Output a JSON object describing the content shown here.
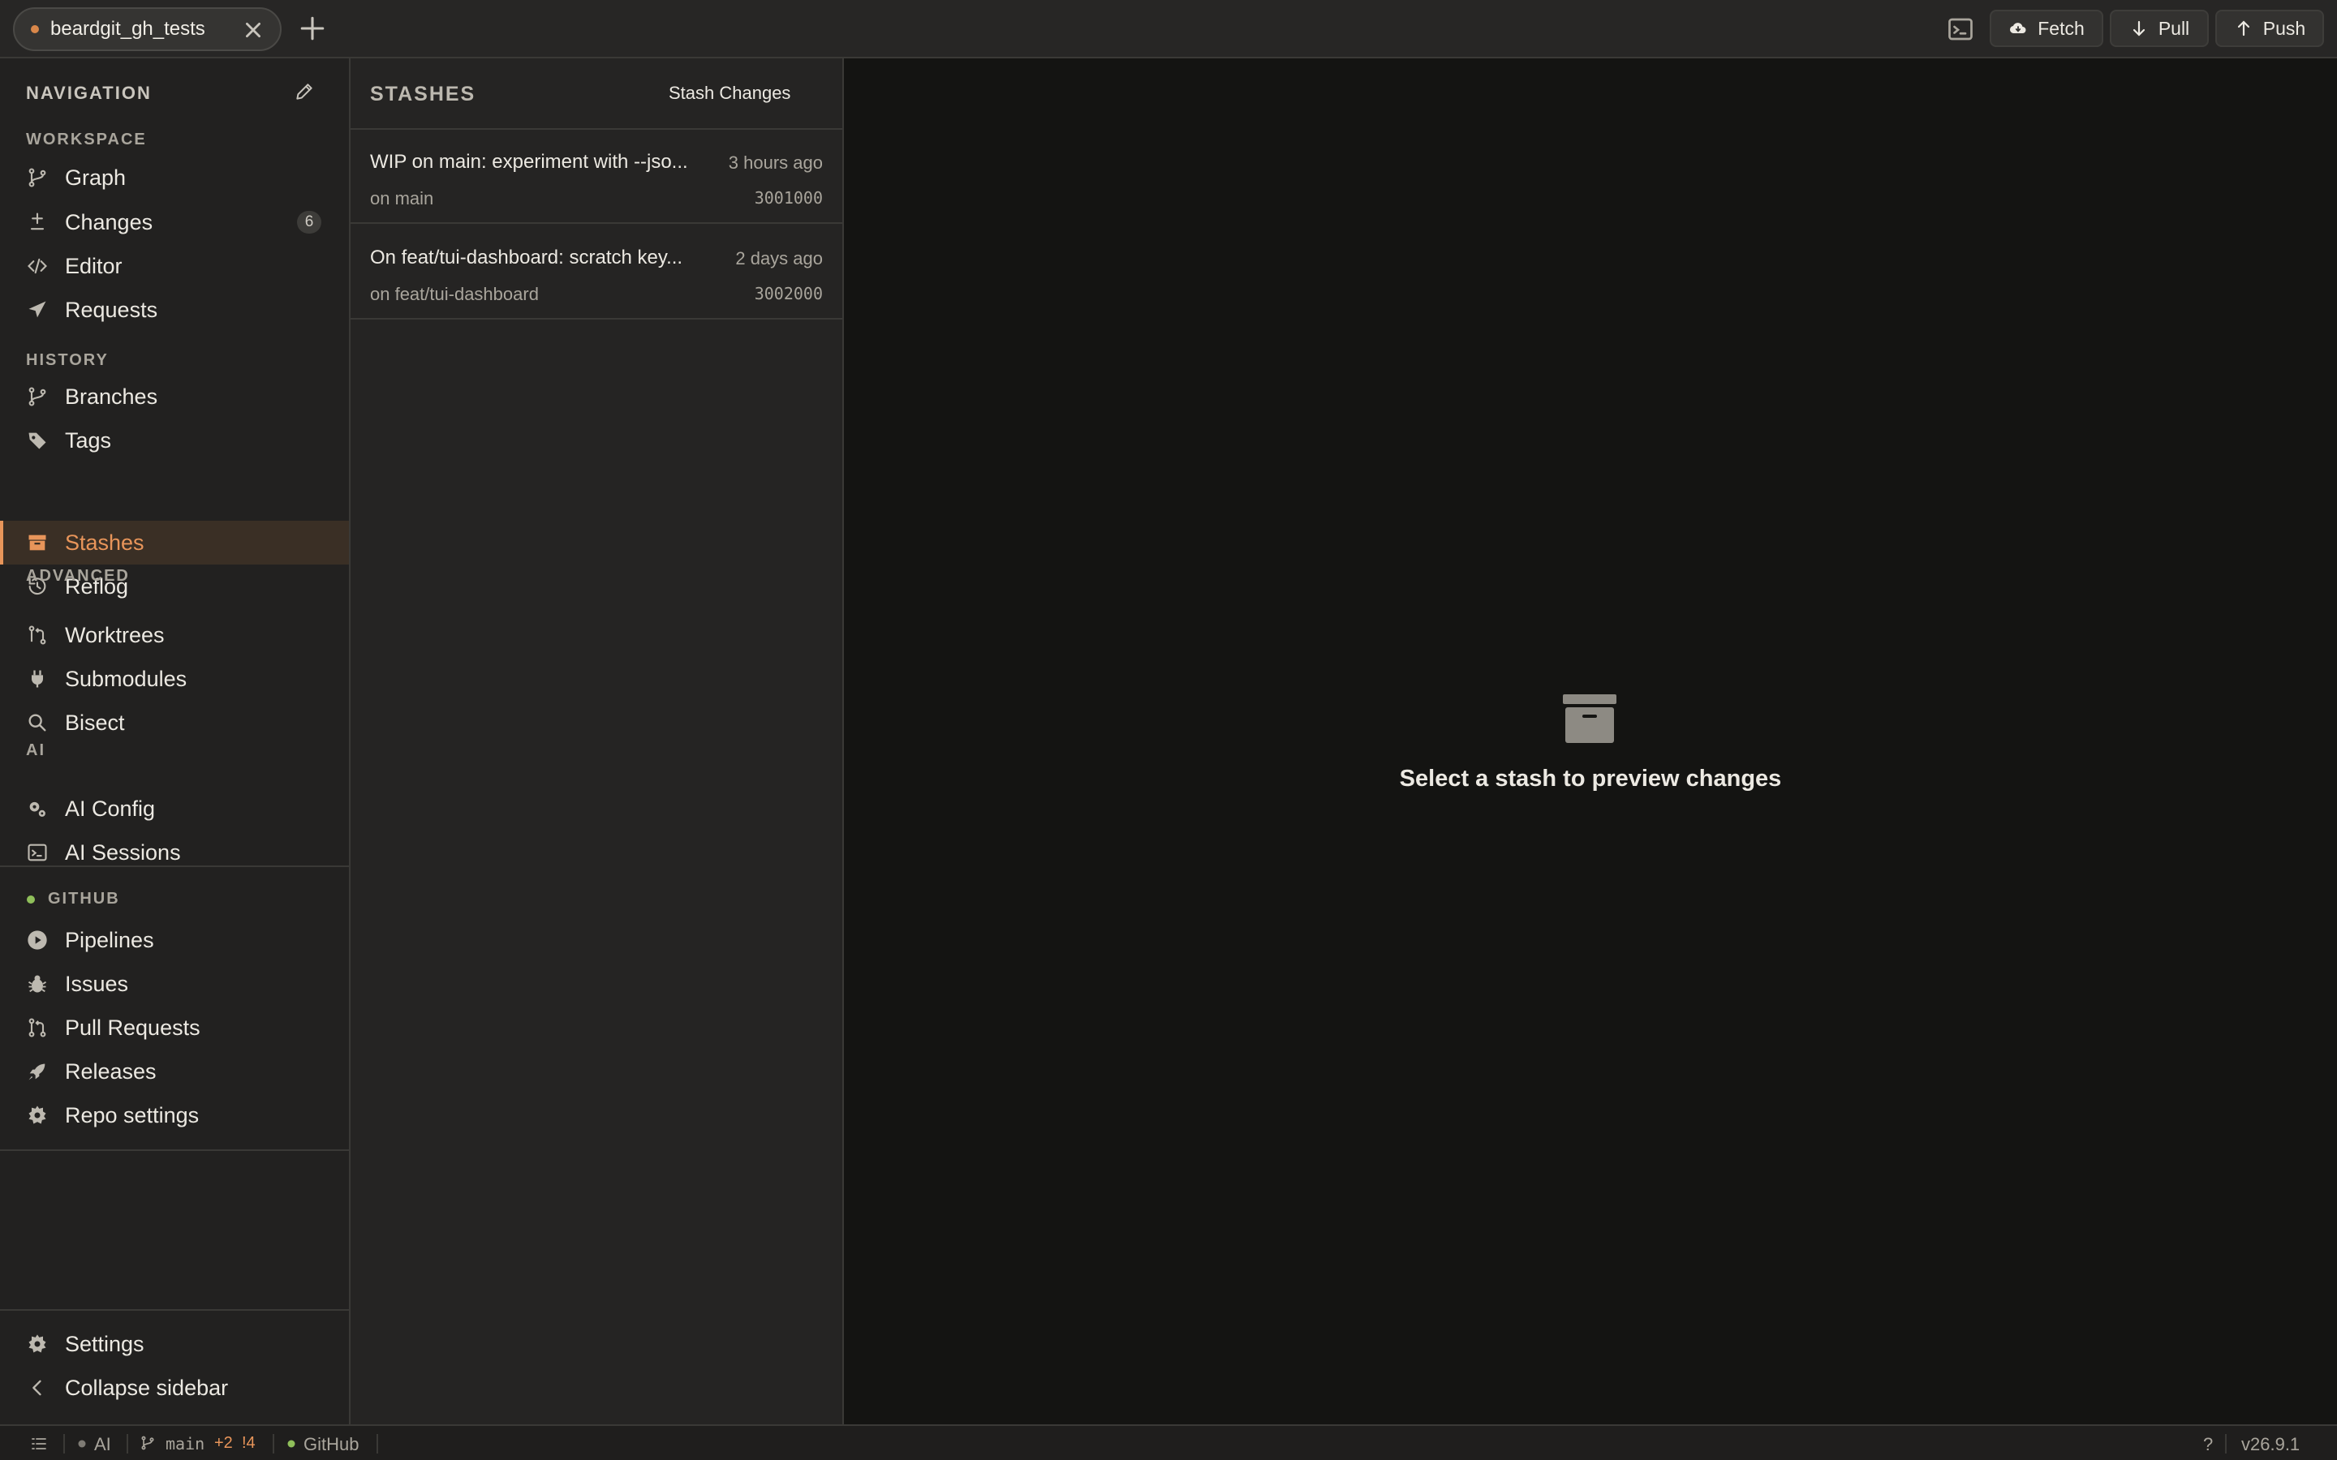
{
  "tab": {
    "repo_name": "beardgit_gh_tests"
  },
  "toolbar": {
    "fetch_label": "Fetch",
    "pull_label": "Pull",
    "push_label": "Push"
  },
  "sidebar": {
    "title": "NAVIGATION",
    "sections": {
      "workspace": "WORKSPACE",
      "history": "HISTORY",
      "advanced": "ADVANCED",
      "ai": "AI",
      "github": "GITHUB"
    },
    "items": {
      "graph": "Graph",
      "changes": "Changes",
      "changes_count": "6",
      "editor": "Editor",
      "requests": "Requests",
      "branches": "Branches",
      "tags": "Tags",
      "stashes": "Stashes",
      "reflog": "Reflog",
      "worktrees": "Worktrees",
      "submodules": "Submodules",
      "bisect": "Bisect",
      "ai_config": "AI Config",
      "ai_sessions": "AI Sessions",
      "pipelines": "Pipelines",
      "issues": "Issues",
      "pull_requests": "Pull Requests",
      "releases": "Releases",
      "repo_settings": "Repo settings",
      "settings": "Settings",
      "collapse": "Collapse sidebar"
    }
  },
  "stashes": {
    "title": "STASHES",
    "action_label": "Stash Changes",
    "rows": [
      {
        "message": "WIP on main: experiment with --jso...",
        "time": "3 hours ago",
        "branch": "on main",
        "sha": "3001000"
      },
      {
        "message": "On feat/tui-dashboard: scratch key...",
        "time": "2 days ago",
        "branch": "on feat/tui-dashboard",
        "sha": "3002000"
      }
    ]
  },
  "main": {
    "empty_message": "Select a stash to preview changes"
  },
  "statusbar": {
    "ai": "AI",
    "branch": "main",
    "ahead": "+2",
    "modified": "!4",
    "github": "GitHub",
    "help": "?",
    "version": "v26.9.1"
  },
  "colors": {
    "accent": "#e8955a",
    "status_ok": "#8fbf5a"
  }
}
